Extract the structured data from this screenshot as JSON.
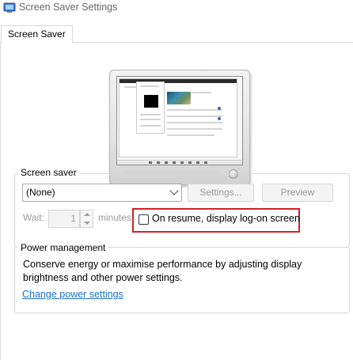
{
  "window": {
    "title": "Screen Saver Settings",
    "icon": "screen-saver-app-icon"
  },
  "tabs": [
    {
      "label": "Screen Saver",
      "selected": true
    }
  ],
  "screen_saver": {
    "group_label": "Screen saver",
    "selected": "(None)",
    "settings_label": "Settings...",
    "preview_label": "Preview",
    "wait_label": "Wait:",
    "wait_value": "1",
    "minutes_label": "minutes",
    "resume_label": "On resume, display log-on screen",
    "resume_checked": false
  },
  "power": {
    "group_label": "Power management",
    "description": "Conserve energy or maximise performance by adjusting display brightness and other power settings.",
    "link_label": "Change power settings"
  },
  "colors": {
    "highlight": "#d42020",
    "link": "#1a6fc4"
  }
}
